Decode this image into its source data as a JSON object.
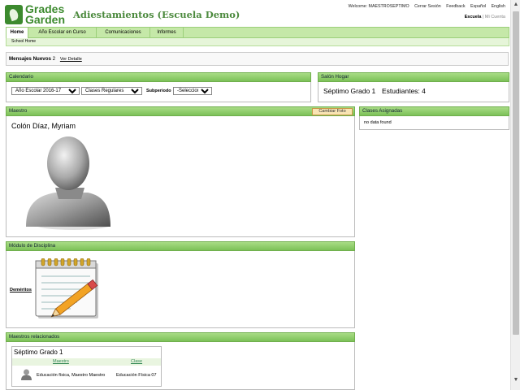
{
  "brand": {
    "logo_line1": "Grades",
    "logo_line2": "Garden"
  },
  "app": {
    "title": "Adiestamientos (Escuela Demo)"
  },
  "top_links": {
    "welcome": "Welcome: MAESTROSEPTIMO",
    "logout": "Cerrar Sesión",
    "feedback": "Feedback",
    "lang_es": "Español",
    "lang_en": "English"
  },
  "school_links": {
    "school": "Escuela",
    "sep": "|",
    "account": "Mi Cuenta"
  },
  "nav": {
    "tabs": [
      "Home",
      "Año Escolar en Curso",
      "Comunicaciones",
      "Informes"
    ],
    "sub": "School Home"
  },
  "messages": {
    "label": "Mensajes Nuevos",
    "count": "2",
    "link": "Ver Detalle"
  },
  "calendar": {
    "title": "Calendario",
    "year": "Año Escolar 2016-17",
    "classes": "Clases Regulares",
    "sub_label": "Subperiodo",
    "sub_value": "-Seleccione -"
  },
  "homeroom": {
    "title": "Salón Hogar",
    "grade": "Séptimo Grado 1",
    "students": "Estudiantes: 4"
  },
  "teacher": {
    "title": "Maestro",
    "button": "Cambiar Foto",
    "name": "Colón Díaz, Myriam"
  },
  "assigned": {
    "title": "Clases Asignadas",
    "empty": "no data found"
  },
  "discipline": {
    "title": "Módulo de Disciplina",
    "link": "Deméritos"
  },
  "related": {
    "title": "Maestros relacionados",
    "group": "Séptimo Grado 1",
    "headers": {
      "teacher": "Maestro",
      "class": "Clase"
    },
    "rows": [
      {
        "teacher": "Educación física, Maestro Maestro",
        "class": "Educación Física 07"
      }
    ]
  },
  "colors": {
    "brand_green": "#3c8a2e",
    "header_green": "#7cc158",
    "nav_green": "#c5e8a8"
  }
}
